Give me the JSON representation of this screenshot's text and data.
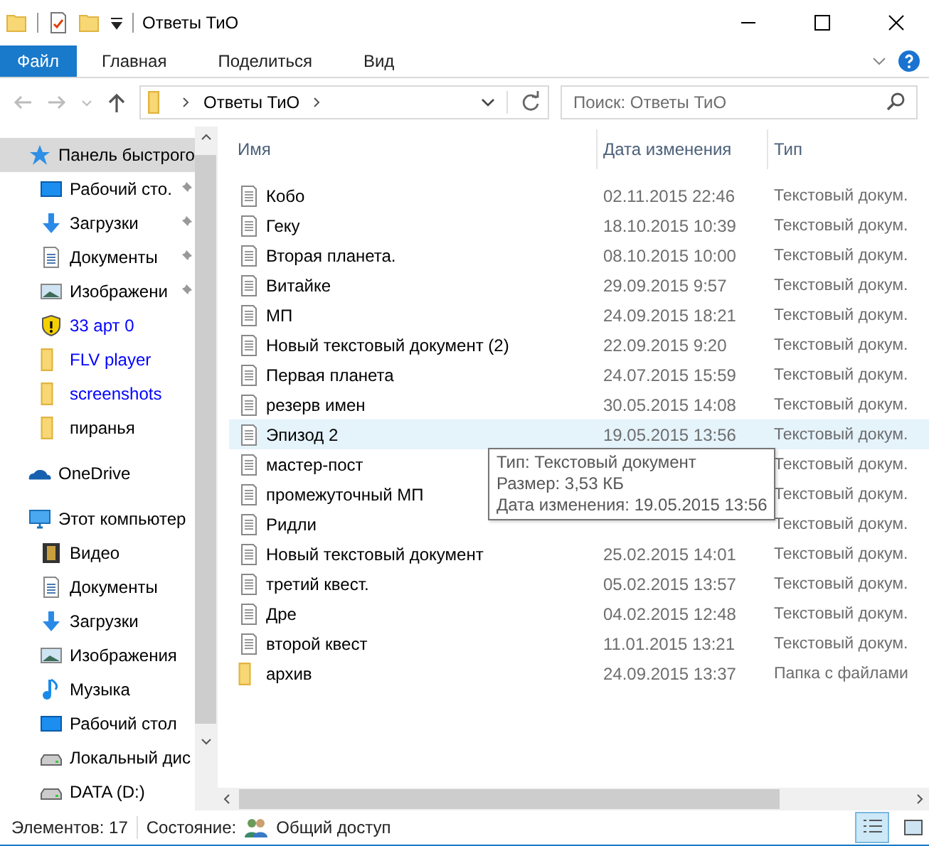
{
  "window": {
    "title": "Ответы ТиО"
  },
  "ribbon_tabs": [
    {
      "label": "Файл",
      "selected": true
    },
    {
      "label": "Главная",
      "selected": false
    },
    {
      "label": "Поделиться",
      "selected": false
    },
    {
      "label": "Вид",
      "selected": false
    }
  ],
  "address": {
    "path": [
      "Ответы ТиО"
    ]
  },
  "search": {
    "placeholder": "Поиск: Ответы ТиО"
  },
  "sidebar": {
    "items": [
      {
        "label": "Панель быстрого",
        "kind": "star",
        "selected": true,
        "pinned": false,
        "color": "#000000",
        "children": [
          {
            "label": "Рабочий сто.",
            "kind": "desktop",
            "selected": false,
            "pinned": true,
            "color": "#000000"
          },
          {
            "label": "Загрузки",
            "kind": "download",
            "selected": false,
            "pinned": true,
            "color": "#000000"
          },
          {
            "label": "Документы",
            "kind": "documents",
            "selected": false,
            "pinned": true,
            "color": "#000000"
          },
          {
            "label": "Изображени",
            "kind": "pictures",
            "selected": false,
            "pinned": true,
            "color": "#000000"
          },
          {
            "label": "33 арт 0",
            "kind": "shield",
            "selected": false,
            "pinned": false,
            "color": "#0000ff"
          },
          {
            "label": "FLV player",
            "kind": "folder",
            "selected": false,
            "pinned": false,
            "color": "#0000ff"
          },
          {
            "label": "screenshots",
            "kind": "folder",
            "selected": false,
            "pinned": false,
            "color": "#0000ff"
          },
          {
            "label": "пиранья",
            "kind": "folder",
            "selected": false,
            "pinned": false,
            "color": "#000000"
          }
        ]
      },
      {
        "label": "OneDrive",
        "kind": "cloud",
        "selected": false,
        "pinned": false,
        "color": "#000000"
      },
      {
        "label": "Этот компьютер",
        "kind": "computer",
        "selected": false,
        "pinned": false,
        "color": "#000000",
        "children": [
          {
            "label": "Видео",
            "kind": "video",
            "selected": false,
            "pinned": false,
            "color": "#000000"
          },
          {
            "label": "Документы",
            "kind": "documents",
            "selected": false,
            "pinned": false,
            "color": "#000000"
          },
          {
            "label": "Загрузки",
            "kind": "download",
            "selected": false,
            "pinned": false,
            "color": "#000000"
          },
          {
            "label": "Изображения",
            "kind": "pictures",
            "selected": false,
            "pinned": false,
            "color": "#000000"
          },
          {
            "label": "Музыка",
            "kind": "music",
            "selected": false,
            "pinned": false,
            "color": "#000000"
          },
          {
            "label": "Рабочий стол",
            "kind": "desktop",
            "selected": false,
            "pinned": false,
            "color": "#000000"
          },
          {
            "label": "Локальный дис",
            "kind": "drive",
            "selected": false,
            "pinned": false,
            "color": "#000000"
          },
          {
            "label": "DATA (D:)",
            "kind": "drive",
            "selected": false,
            "pinned": false,
            "color": "#000000"
          }
        ]
      }
    ]
  },
  "table": {
    "columns": [
      "Имя",
      "Дата изменения",
      "Тип"
    ],
    "rows": [
      {
        "name": "Кобо",
        "kind": "text",
        "date": "02.11.2015 22:46",
        "type": "Текстовый докум.",
        "hovered": false
      },
      {
        "name": "Геку",
        "kind": "text",
        "date": "18.10.2015 10:39",
        "type": "Текстовый докум.",
        "hovered": false
      },
      {
        "name": "Вторая планета.",
        "kind": "text",
        "date": "08.10.2015 10:00",
        "type": "Текстовый докум.",
        "hovered": false
      },
      {
        "name": "Витайке",
        "kind": "text",
        "date": "29.09.2015 9:57",
        "type": "Текстовый докум.",
        "hovered": false
      },
      {
        "name": "МП",
        "kind": "text",
        "date": "24.09.2015 18:21",
        "type": "Текстовый докум.",
        "hovered": false
      },
      {
        "name": "Новый текстовый документ (2)",
        "kind": "text",
        "date": "22.09.2015 9:20",
        "type": "Текстовый докум.",
        "hovered": false
      },
      {
        "name": "Первая планета",
        "kind": "text",
        "date": "24.07.2015 15:59",
        "type": "Текстовый докум.",
        "hovered": false
      },
      {
        "name": "резерв имен",
        "kind": "text",
        "date": "30.05.2015 14:08",
        "type": "Текстовый докум.",
        "hovered": false
      },
      {
        "name": "Эпизод 2",
        "kind": "text",
        "date": "19.05.2015 13:56",
        "type": "Текстовый докум.",
        "hovered": true
      },
      {
        "name": "мастер-пост",
        "kind": "text",
        "type": "Текстовый докум.",
        "hovered": false
      },
      {
        "name": "промежуточный МП",
        "kind": "text",
        "type": "Текстовый докум.",
        "hovered": false
      },
      {
        "name": "Ридли",
        "kind": "text",
        "type": "Текстовый докум.",
        "hovered": false
      },
      {
        "name": "Новый текстовый документ",
        "kind": "text",
        "date": "25.02.2015 14:01",
        "type": "Текстовый докум.",
        "hovered": false
      },
      {
        "name": "третий квест.",
        "kind": "text",
        "date": "05.02.2015 13:57",
        "type": "Текстовый докум.",
        "hovered": false
      },
      {
        "name": "Дре",
        "kind": "text",
        "date": "04.02.2015 12:48",
        "type": "Текстовый докум.",
        "hovered": false
      },
      {
        "name": "второй квест",
        "kind": "text",
        "date": "11.01.2015 13:21",
        "type": "Текстовый докум.",
        "hovered": false
      },
      {
        "name": "архив",
        "kind": "folder",
        "date": "24.09.2015 13:37",
        "type": "Папка с файлами",
        "hovered": false
      }
    ]
  },
  "tooltip": {
    "lines": [
      "Тип: Текстовый документ",
      "Размер: 3,53 КБ",
      "Дата изменения: 19.05.2015 13:56"
    ]
  },
  "status_bar": {
    "count": "Элементов: 17",
    "state_label": "Состояние:",
    "state": "Общий доступ"
  }
}
